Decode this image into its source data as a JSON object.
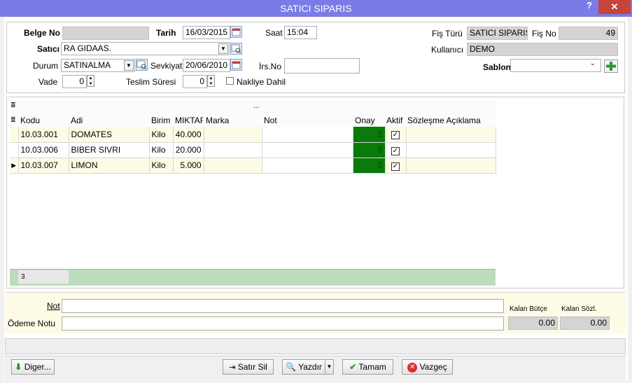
{
  "window": {
    "title": "SATICI SIPARIS",
    "help": "?",
    "close": "✕"
  },
  "header": {
    "belge_no_label": "Belge No",
    "belge_no": "",
    "tarih_label": "Tarih",
    "tarih": "16/03/2015",
    "saat_label": "Saat",
    "saat": "15:04",
    "fis_turu_label": "Fiş Türü",
    "fis_turu": "SATICI SIPARIS",
    "fis_no_label": "Fiş No",
    "fis_no": "49",
    "satici_label": "Satıcı",
    "satici": "RA GIDAAS.",
    "kullanici_label": "Kullanıcı",
    "kullanici": "DEMO",
    "durum_label": "Durum",
    "durum": "SATINALMA",
    "sevkiyat_label": "Sevkiyat",
    "sevkiyat": "20/06/2010",
    "irs_no_label": "İrs.No",
    "irs_no": "",
    "sablon_label": "Sablon",
    "sablon": "",
    "vade_label": "Vade",
    "vade": "0",
    "teslim_label": "Teslim Süresi",
    "teslim": "0",
    "nakliye_label": "Nakliye Dahil"
  },
  "grid": {
    "group_row": "...",
    "columns": [
      "Kodu",
      "Adi",
      "Birim",
      "MIKTAF",
      "Marka",
      "Not",
      "Onay",
      "Aktif",
      "Sözleşme Açıklama"
    ],
    "rows": [
      {
        "kodu": "10.03.001",
        "adi": "DOMATES",
        "birim": "Kilo",
        "miktar": "40.000",
        "marka": "",
        "not": "",
        "onay": "5",
        "aktif": true,
        "aciklama": ""
      },
      {
        "kodu": "10.03.006",
        "adi": "BIBER SIVRI",
        "birim": "Kilo",
        "miktar": "20.000",
        "marka": "",
        "not": "",
        "onay": "5",
        "aktif": true,
        "aciklama": ""
      },
      {
        "kodu": "10.03.007",
        "adi": "LIMON",
        "birim": "Kilo",
        "miktar": "5.000",
        "marka": "",
        "not": "",
        "onay": "5",
        "aktif": true,
        "aciklama": ""
      }
    ],
    "footer_count": "3"
  },
  "footer": {
    "not_label": "Not",
    "not": "",
    "odeme_label": "Ödeme Notu",
    "odeme": "",
    "kalan_butce_label": "Kalan Bütçe",
    "kalan_butce": "0.00",
    "kalan_sozl_label": "Kalan Sözl.",
    "kalan_sozl": "0.00"
  },
  "buttons": {
    "diger": "Diger...",
    "satir_sil": "Satır Sil",
    "yazdir": "Yazdır",
    "tamam": "Tamam",
    "vazgec": "Vazgeç"
  },
  "colors": {
    "titlebar": "#7b7be8",
    "onay_cell": "#0a7a0a",
    "grid_footer": "#bcdcbc",
    "highlight_row": "#fdfbe6"
  }
}
